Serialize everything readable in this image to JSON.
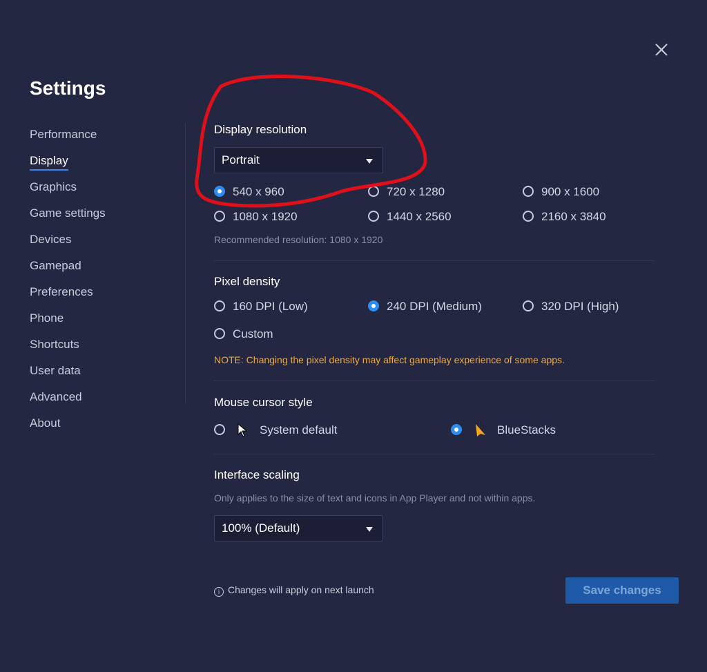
{
  "title": "Settings",
  "sidebar": {
    "items": [
      {
        "label": "Performance"
      },
      {
        "label": "Display"
      },
      {
        "label": "Graphics"
      },
      {
        "label": "Game settings"
      },
      {
        "label": "Devices"
      },
      {
        "label": "Gamepad"
      },
      {
        "label": "Preferences"
      },
      {
        "label": "Phone"
      },
      {
        "label": "Shortcuts"
      },
      {
        "label": "User data"
      },
      {
        "label": "Advanced"
      },
      {
        "label": "About"
      }
    ],
    "active": "Display"
  },
  "display_resolution": {
    "title": "Display resolution",
    "orientation_selected": "Portrait",
    "options": [
      "540 x 960",
      "720 x 1280",
      "900 x 1600",
      "1080 x 1920",
      "1440 x 2560",
      "2160 x 3840"
    ],
    "selected": "540 x 960",
    "recommended": "Recommended resolution: 1080 x 1920"
  },
  "pixel_density": {
    "title": "Pixel density",
    "options": [
      "160 DPI (Low)",
      "240 DPI (Medium)",
      "320 DPI (High)",
      "Custom"
    ],
    "selected": "240 DPI (Medium)",
    "note": "NOTE: Changing the pixel density may affect gameplay experience of some apps."
  },
  "mouse_cursor": {
    "title": "Mouse cursor style",
    "options": [
      "System default",
      "BlueStacks"
    ],
    "selected": "BlueStacks"
  },
  "interface_scaling": {
    "title": "Interface scaling",
    "hint": "Only applies to the size of text and icons in App Player and not within apps.",
    "selected": "100% (Default)"
  },
  "footer": {
    "note": "Changes will apply on next launch",
    "save_label": "Save changes"
  },
  "colors": {
    "background": "#232742",
    "accent": "#2e8cf0",
    "note": "#f2a93b",
    "annotation": "#e0101b"
  }
}
